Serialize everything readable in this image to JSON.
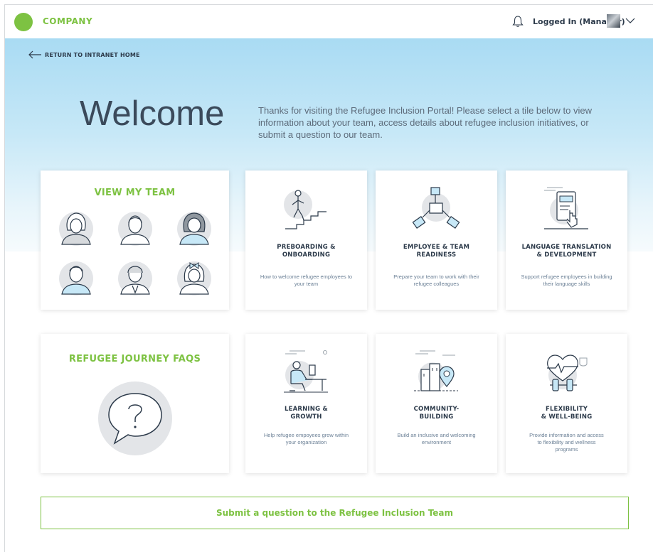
{
  "header": {
    "brand": "COMPANY",
    "user_label": "Logged In (Manager)",
    "accent": "#7dc242"
  },
  "nav": {
    "back_label": "RETURN TO INTRANET HOME"
  },
  "hero": {
    "title": "Welcome",
    "intro": "Thanks for visiting the Refugee Inclusion Portal! Please select a tile below to view information about your team, access details about refugee inclusion initiatives, or submit a question to our team."
  },
  "team": {
    "title": "VIEW MY TEAM"
  },
  "faqs": {
    "title": "REFUGEE JOURNEY FAQS"
  },
  "tiles": [
    {
      "title_1": "PREBOARDING &",
      "title_2": "ONBOARDING",
      "desc_1": "How to welcome refugee employees to",
      "desc_2": "your team",
      "icon": "stairs-climber-icon"
    },
    {
      "title_1": "EMPLOYEE & TEAM",
      "title_2": "READINESS",
      "desc_1": "Prepare your team to work with their",
      "desc_2": "refugee colleagues",
      "icon": "team-hands-icon"
    },
    {
      "title_1": "LANGUAGE TRANSLATION",
      "title_2": "& DEVELOPMENT",
      "desc_1": "Support refugee employees in building",
      "desc_2": "their language skills",
      "icon": "tablet-tap-icon"
    },
    {
      "title_1": "LEARNING &",
      "title_2": "GROWTH",
      "desc_1": "Help refugee empoyees grow within",
      "desc_2": "your organization",
      "icon": "desk-learner-icon"
    },
    {
      "title_1": "COMMUNITY-",
      "title_2": "BUILDING",
      "desc_1": "Build an inclusive and welcoming",
      "desc_2": "environment",
      "icon": "city-location-icon"
    },
    {
      "title_1": "FLEXIBILITY",
      "title_2": "& WELL-BEING",
      "desc_1": "Provide information and access",
      "desc_2": "to flexibility and wellness",
      "desc_3": "programs",
      "icon": "heart-dumbbell-icon"
    }
  ],
  "submit": {
    "label": "Submit a question to the Refugee Inclusion Team"
  }
}
